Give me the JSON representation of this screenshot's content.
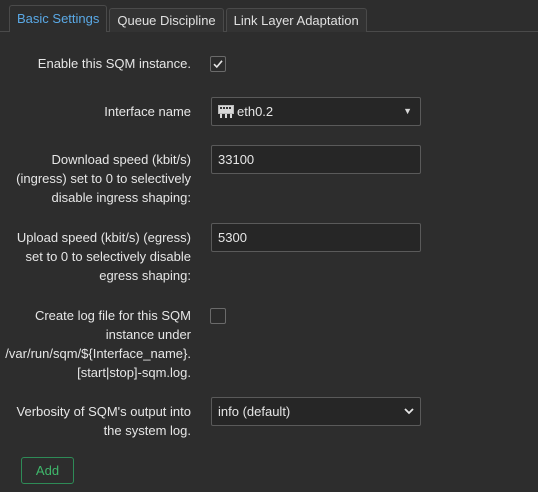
{
  "tabs": [
    {
      "label": "Basic Settings",
      "active": true
    },
    {
      "label": "Queue Discipline",
      "active": false
    },
    {
      "label": "Link Layer Adaptation",
      "active": false
    }
  ],
  "enable": {
    "label": "Enable this SQM instance.",
    "checked": true
  },
  "interface": {
    "label": "Interface name",
    "value": "eth0.2",
    "icon": "network-port-icon"
  },
  "download": {
    "label_lines": [
      "Download speed (kbit/s)",
      "(ingress) set to 0 to selectively",
      "disable ingress shaping:"
    ],
    "value": "33100"
  },
  "upload": {
    "label_lines": [
      "Upload speed (kbit/s) (egress)",
      "set to 0 to selectively disable",
      "egress shaping:"
    ],
    "value": "5300"
  },
  "logfile": {
    "label_lines": [
      "Create log file for this SQM",
      "instance under",
      "/var/run/sqm/${Interface_name}.",
      "[start|stop]-sqm.log."
    ],
    "checked": false
  },
  "verbosity": {
    "label_lines": [
      "Verbosity of SQM's output into",
      "the system log."
    ],
    "value": "info (default)"
  },
  "add_label": "Add",
  "colors": {
    "background": "#2d2d2d",
    "accent": "#5aa9e6",
    "add": "#3fb86b"
  }
}
